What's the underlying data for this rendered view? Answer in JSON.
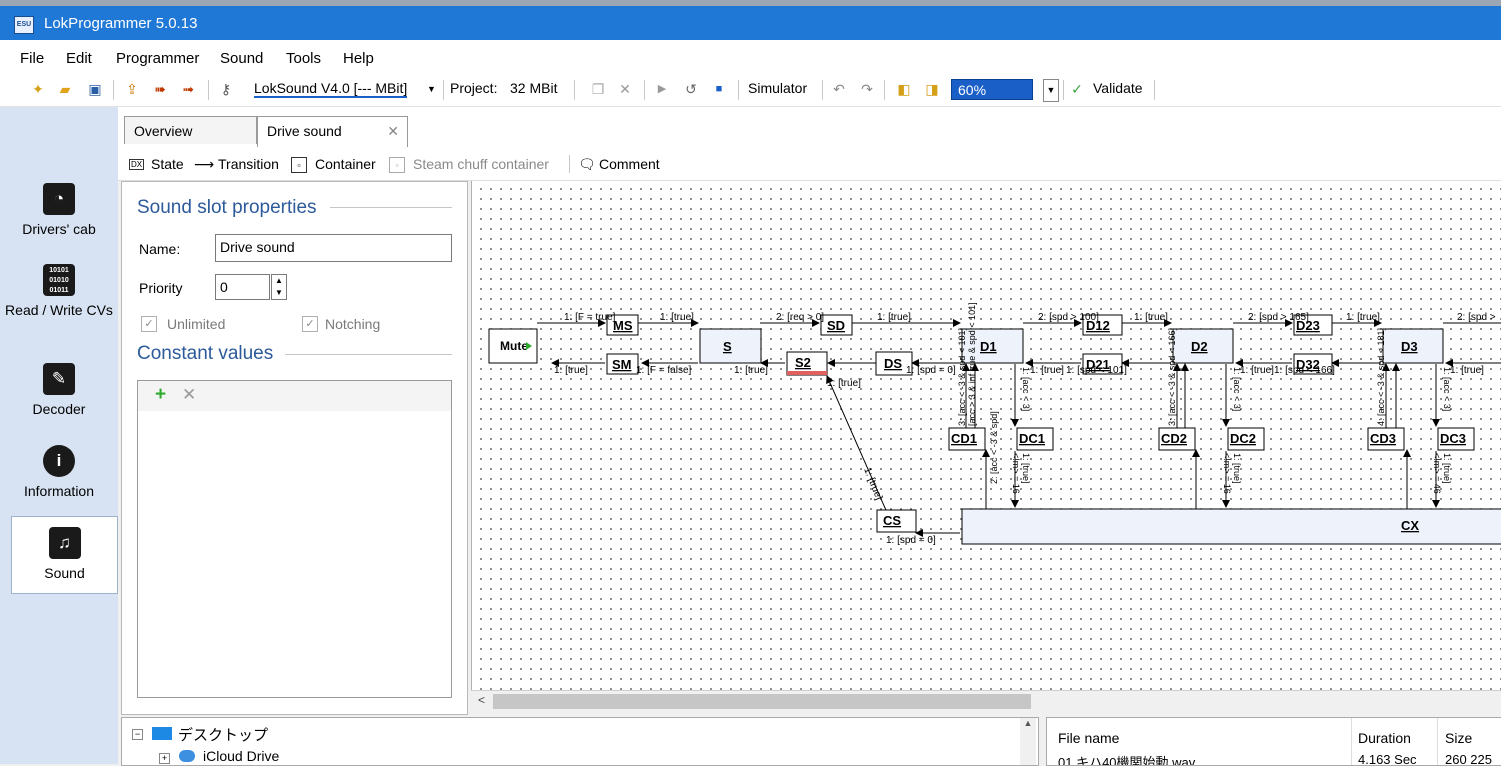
{
  "window": {
    "title": "LokProgrammer 5.0.13",
    "icon": "esu-app-icon",
    "icon_text": "ESU"
  },
  "menu": [
    "File",
    "Edit",
    "Programmer",
    "Sound",
    "Tools",
    "Help"
  ],
  "toolbar": {
    "decoder_select": "LokSound V4.0 [--- MBit]",
    "project_label": "Project:",
    "project_size": "32 MBit",
    "simulator": "Simulator",
    "zoom": "60%",
    "validate": "Validate"
  },
  "nav": [
    {
      "label": "Drivers' cab",
      "icon": "drivers-cab-icon"
    },
    {
      "label": "Read / Write CVs",
      "icon": "read-write-cv-icon",
      "icon_text": "10101 01010 01011"
    },
    {
      "label": "Decoder",
      "icon": "wrench-icon"
    },
    {
      "label": "Information",
      "icon": "info-icon"
    },
    {
      "label": "Sound",
      "icon": "music-note-icon"
    }
  ],
  "tabs": [
    {
      "label": "Overview"
    },
    {
      "label": "Drive sound",
      "active": true
    }
  ],
  "sound_toolbar": {
    "state": "State",
    "state_icon_text": "DX",
    "transition": "Transition",
    "container": "Container",
    "steam_chuff": "Steam chuff container",
    "comment": "Comment"
  },
  "properties": {
    "group_title": "Sound slot properties",
    "name_label": "Name:",
    "name_value": "Drive sound",
    "priority_label": "Priority",
    "priority_value": "0",
    "unlimited": "Unlimited",
    "notching": "Notching",
    "constants_title": "Constant values"
  },
  "diagram": {
    "states": [
      "Mute",
      "MS",
      "SM",
      "S",
      "S2",
      "SD",
      "DS",
      "D1",
      "D12",
      "D21",
      "D2",
      "D23",
      "D32",
      "D3",
      "CD1",
      "DC1",
      "CD2",
      "DC2",
      "CD3",
      "DC3",
      "CS",
      "CX"
    ],
    "labels": {
      "mute_ms": "1: [F = true]",
      "ms_s": "1: [true]",
      "s_sd": "2: [req > 0]",
      "sd_d1": "1: [true]",
      "d1_d12": "2: [spd > 100]",
      "d12_d2": "1: [true]",
      "d2_d23": "2: [spd > 165]",
      "d23_d3": "1: [true]",
      "d3_next": "2: [spd >",
      "sm_mute": "1: [true]",
      "s_sm": "1: [F = false]",
      "s2_s": "1: [true]",
      "ds_s2": "1: [spd = 0]",
      "d21_d1": "1: [true]",
      "d2_d21": "1: [spd < 101]",
      "d32_d2": "1: [true]",
      "d3_d32": "1: [spd < 166]",
      "d4_d3": "1: [true]",
      "s2_up": "1: [true]",
      "cs_s2": "1: [true]",
      "cx_cs": "1: [spd = 0]",
      "d1_ds": "1: [spd = 0]",
      "v_d1_1": "3: [acc < -3 & spd < 101]",
      "v_cd1_1": "[acc > 3 & inf true & spd < 101]",
      "v_d1_dc1": "1: [acc < 3]",
      "v_dc1_cx": "1: [true]",
      "v_cx_dc1": "<!m> = 16",
      "v_cd1_cx": "2: [acc < -3 & spd]",
      "v_d2_1": "3: [acc < -3 & spd < 166]",
      "v_d2_dc2": "1: [acc < 3]",
      "v_dc2_cx": "1: [true]",
      "v_cx_dc2": "<!m> = 16",
      "v_d3_1": "4: [acc < -3 & spd < 181]",
      "v_d3_dc3": "1: [acc < 3]",
      "v_dc3_cx": "1: [true]",
      "v_cx_dc3": "<!m> = 46"
    }
  },
  "tree": {
    "root": "デスクトップ",
    "child": "iCloud Drive"
  },
  "files": {
    "col_name": "File name",
    "col_duration": "Duration",
    "col_size": "Size",
    "row_name": "01 キハ40機関始動.wav",
    "row_duration": "4.163 Sec",
    "row_size": "260 225 b"
  }
}
